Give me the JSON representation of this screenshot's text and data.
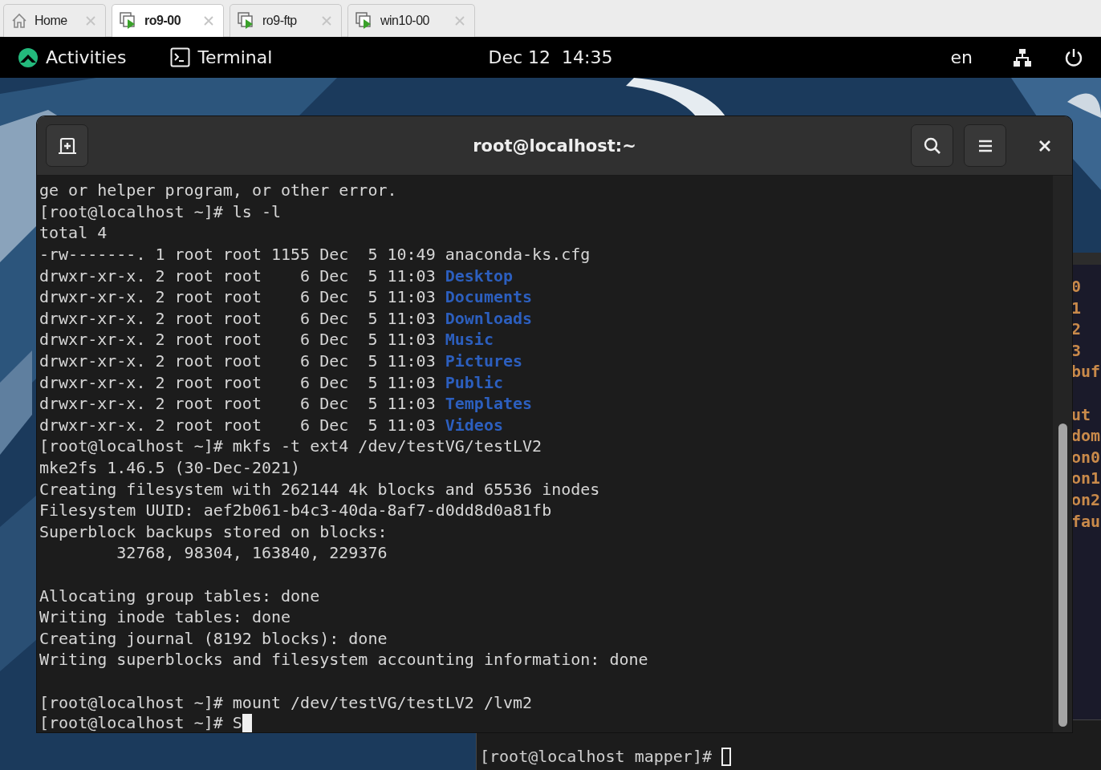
{
  "browser_tabs": [
    {
      "label": "Home",
      "kind": "home",
      "selected": false
    },
    {
      "label": "ro9-00",
      "kind": "vm",
      "selected": true
    },
    {
      "label": "ro9-ftp",
      "kind": "vm",
      "selected": false
    },
    {
      "label": "win10-00",
      "kind": "vm",
      "selected": false
    }
  ],
  "top_bar": {
    "activities": "Activities",
    "app": "Terminal",
    "clock": "Dec 12  14:35",
    "keyboard": "en"
  },
  "terminal": {
    "title": "root@localhost:~",
    "focused": true,
    "blocks": [
      [
        {
          "text": "ge or helper program, or other error."
        },
        {
          "text": "[root@localhost ~]# ls -l"
        },
        {
          "text": "total 4"
        },
        {
          "text": "-rw-------. 1 root root 1155 Dec  5 10:49 anaconda-ks.cfg"
        },
        {
          "text": "drwxr-xr-x. 2 root root    6 Dec  5 11:03 ",
          "directory": "Desktop"
        },
        {
          "text": "drwxr-xr-x. 2 root root    6 Dec  5 11:03 ",
          "directory": "Documents"
        },
        {
          "text": "drwxr-xr-x. 2 root root    6 Dec  5 11:03 ",
          "directory": "Downloads"
        },
        {
          "text": "drwxr-xr-x. 2 root root    6 Dec  5 11:03 ",
          "directory": "Music"
        },
        {
          "text": "drwxr-xr-x. 2 root root    6 Dec  5 11:03 ",
          "directory": "Pictures"
        },
        {
          "text": "drwxr-xr-x. 2 root root    6 Dec  5 11:03 ",
          "directory": "Public"
        },
        {
          "text": "drwxr-xr-x. 2 root root    6 Dec  5 11:03 ",
          "directory": "Templates"
        },
        {
          "text": "drwxr-xr-x. 2 root root    6 Dec  5 11:03 ",
          "directory": "Videos"
        },
        {
          "text": "[root@localhost ~]# mkfs -t ext4 /dev/testVG/testLV2"
        },
        {
          "text": "mke2fs 1.46.5 (30-Dec-2021)"
        },
        {
          "text": "Creating filesystem with 262144 4k blocks and 65536 inodes"
        },
        {
          "text": "Filesystem UUID: aef2b061-b4c3-40da-8af7-d0dd8d0a81fb"
        },
        {
          "text": "Superblock backups stored on blocks:"
        },
        {
          "text": "        32768, 98304, 163840, 229376"
        }
      ],
      [
        {
          "text": "Allocating group tables: done"
        },
        {
          "text": "Writing inode tables: done"
        },
        {
          "text": "Creating journal (8192 blocks): done"
        },
        {
          "text": "Writing superblocks and filesystem accounting information: done"
        }
      ],
      [
        {
          "text": "[root@localhost ~]# mount /dev/testVG/testLV2 /lvm2"
        },
        {
          "text": "[root@localhost ~]# S"
        }
      ]
    ]
  },
  "background_windows": [
    {
      "kind": "side",
      "blocks": [
        [
          {
            "text": "0"
          },
          {
            "text": "1"
          },
          {
            "text": "2"
          },
          {
            "text": "3"
          },
          {
            "text": "buf"
          }
        ],
        [
          {
            "text": "ut"
          },
          {
            "text": "dom"
          },
          {
            "text": "on0"
          },
          {
            "text": "on1"
          },
          {
            "text": "on2"
          },
          {
            "text": "fau"
          }
        ]
      ]
    },
    {
      "kind": "bottom",
      "focused": false,
      "blocks": [
        [
          {
            "text": "[root@localhost mapper]# "
          }
        ]
      ]
    }
  ]
}
